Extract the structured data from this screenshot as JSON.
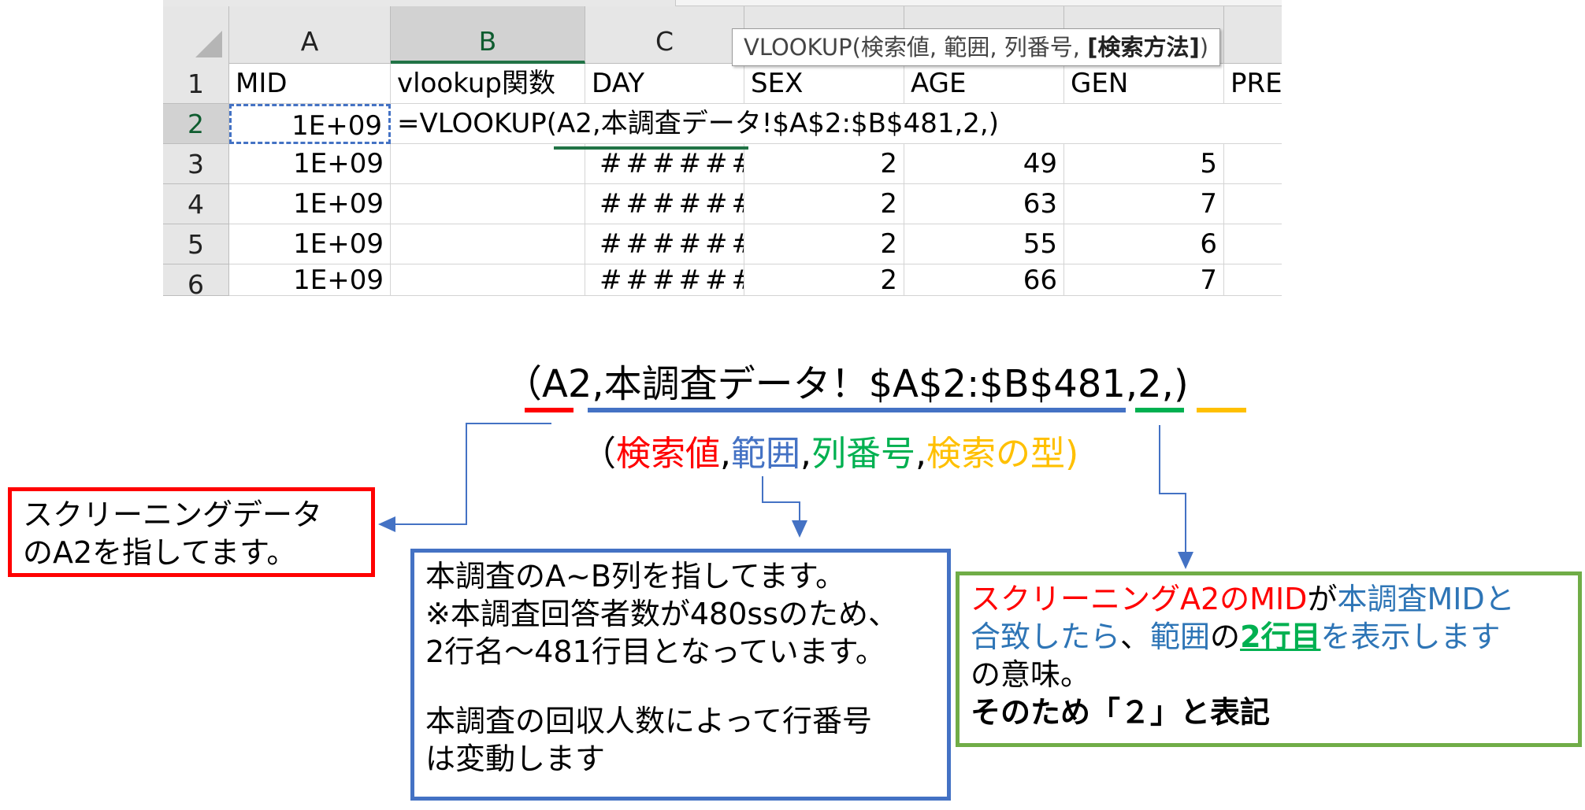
{
  "spreadsheet": {
    "columns": [
      "A",
      "B",
      "C"
    ],
    "rows": [
      "1",
      "2",
      "3",
      "4",
      "5",
      "6"
    ],
    "header_row": [
      "MID",
      "vlookup関数",
      "DAY",
      "SEX",
      "AGE",
      "GEN",
      "PRE"
    ],
    "formula": "=VLOOKUP(A2,本調査データ!$A$2:$B$481,2,)",
    "row2_mid": "1E+09",
    "data_rows": [
      {
        "mid": "1E+09",
        "day": "######",
        "sex": "2",
        "age": "49",
        "gen": "5"
      },
      {
        "mid": "1E+09",
        "day": "######",
        "sex": "2",
        "age": "63",
        "gen": "7"
      },
      {
        "mid": "1E+09",
        "day": "######",
        "sex": "2",
        "age": "55",
        "gen": "6"
      },
      {
        "mid": "1E+09",
        "day": "######",
        "sex": "2",
        "age": "66",
        "gen": "7"
      }
    ],
    "tooltip": {
      "prefix": "VLOOKUP(検索値, 範囲, 列番号, ",
      "bold": "[検索方法]",
      "suffix": ")"
    }
  },
  "explanation": {
    "formula_args": "（A2,本調査データ！$A$2:$B$481,2,)",
    "open_paren": "（",
    "arg1": "検索値",
    "arg2": "範囲",
    "arg3": "列番号",
    "arg4": "検索の型",
    "sep": ",",
    "close_paren": ")"
  },
  "red_box": {
    "line1": "スクリーニングデータ",
    "line2": "のA2を指してます。"
  },
  "blue_box": {
    "line1": "本調査のA~B列を指してます。",
    "line2": "※本調査回答者数が480ssのため、",
    "line3": "2行名～481行目となっています。",
    "line4": "本調査の回収人数によって行番号",
    "line5": "は変動します"
  },
  "green_box": {
    "p1": "スクリーニングA2のMID",
    "p2": "が",
    "p3": "本調査MIDと",
    "p4": "合致したら",
    "p5": "、",
    "p6": "範囲",
    "p7": "の",
    "p8": "2行目",
    "p9": "を表示します",
    "p10": "の意味。",
    "p11": "そのため「２」と表記"
  },
  "colors": {
    "red": "#ff0000",
    "blue": "#4472c4",
    "green": "#00b050",
    "gold": "#ffc000",
    "excel_green": "#217346"
  }
}
